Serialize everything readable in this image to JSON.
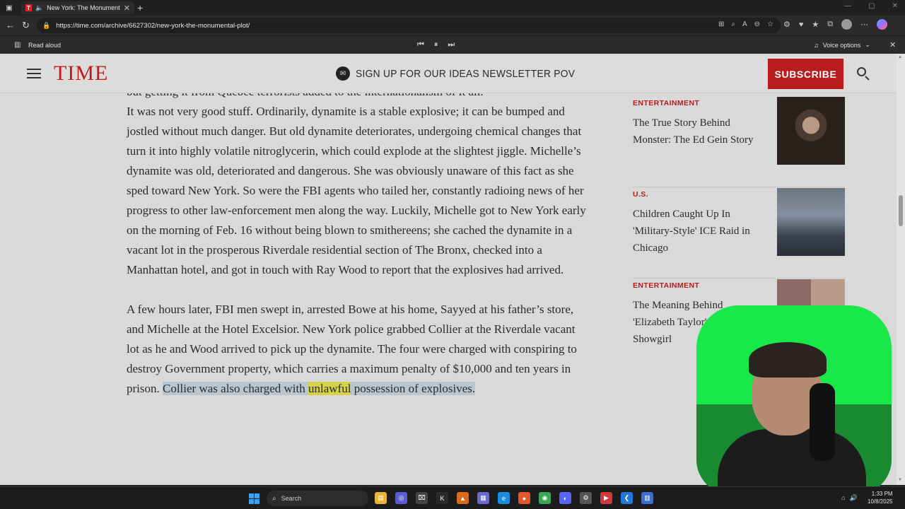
{
  "browser": {
    "tab_title": "New York: The Monumental",
    "tab_favicon": "T",
    "url": "https://time.com/archive/6627302/new-york-the-monumental-plot/",
    "read_aloud_label": "Read aloud",
    "voice_options_label": "Voice options"
  },
  "header": {
    "logo": "TIME",
    "newsletter_text": "SIGN UP FOR OUR IDEAS NEWSLETTER POV",
    "subscribe_label": "SUBSCRIBE"
  },
  "article": {
    "cut_line": "but getting it from Quebec terrorists added to the internationalism of it all.",
    "paragraph_1": "It was not very good stuff. Ordinarily, dynamite is a stable explosive; it can be bumped and jostled without much danger. But old dynamite deteriorates, undergoing chemical changes that turn it into highly volatile nitroglycerin, which could explode at the slightest jiggle. Michelle’s dynamite was old, deteriorated and dangerous. She was obviously unaware of this fact as she sped toward New York. So were the FBI agents who tailed her, constantly radioing news of her progress to other law-enforcement men along the way. Luckily, Michelle got to New York early on the morning of Feb. 16 without being blown to smithereens; she cached the dynamite in a vacant lot in the prosperous Riverdale residential section of The Bronx, checked into a Manhattan hotel, and got in touch with Ray Wood to report that the explosives had arrived.",
    "paragraph_2": "A few hours later, FBI men swept in, arrested Bowe at his home, Sayyed at his father’s store, and Michelle at the Hotel Excelsior. New York police grabbed Collier at the Riverdale vacant lot as he and Wood arrived to pick up the dynamite. The four were charged with conspiring to destroy Government property, which carries a maximum penalty of $10,000 and ten years in prison.",
    "highlight_before": "Collier was also charged with ",
    "highlight_word": "unlawful",
    "highlight_after": " possession of explosives."
  },
  "sidebar": {
    "cards": [
      {
        "category": "ENTERTAINMENT",
        "title": "The True Story Behind Monster: The Ed Gein Story"
      },
      {
        "category": "U.S.",
        "title": "Children Caught Up In 'Military-Style' ICE Raid in Chicago"
      },
      {
        "category": "ENTERTAINMENT",
        "title": "The Meaning Behind 'Elizabeth Taylor' Life of a Showgirl"
      }
    ]
  },
  "taskbar": {
    "search_placeholder": "Search",
    "time": "1:33 PM",
    "date": "10/8/2025"
  }
}
